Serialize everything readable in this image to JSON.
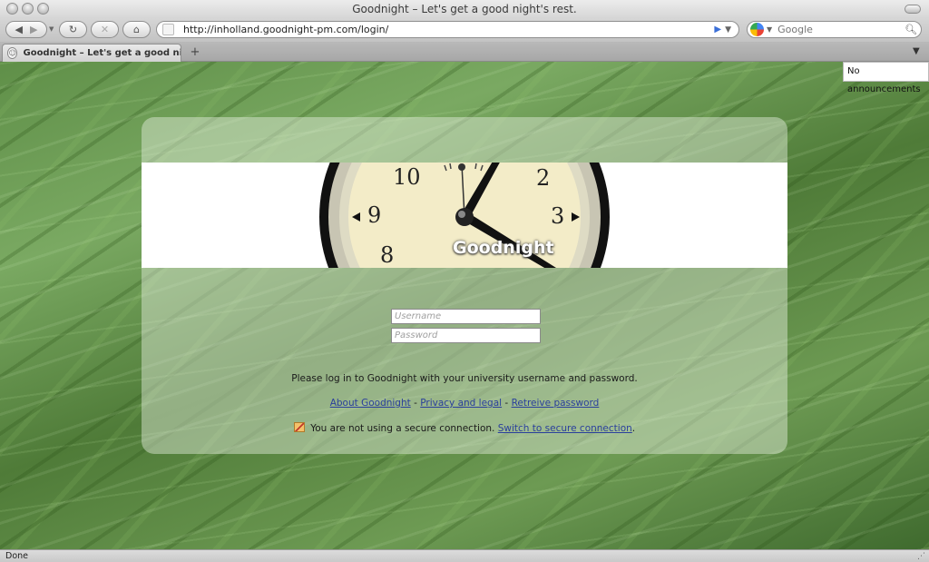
{
  "window": {
    "title": "Goodnight – Let's get a good night's rest."
  },
  "toolbar": {
    "url": "http://inholland.goodnight-pm.com/login/",
    "search_placeholder": "Google"
  },
  "tabs": [
    {
      "label": "Goodnight – Let's get a good nigh..."
    }
  ],
  "page": {
    "announcement": "No announcements",
    "logo_text": "Goodnight",
    "clock_numerals": [
      "10",
      "2",
      "9",
      "3",
      "8"
    ],
    "username_placeholder": "Username",
    "password_placeholder": "Password",
    "login_prompt": "Please log in to Goodnight with your university username and password.",
    "links": {
      "about": "About Goodnight",
      "separator": "-",
      "privacy": "Privacy and legal",
      "retrieve": "Retreive password"
    },
    "secure": {
      "message": "You are not using a secure connection.",
      "switch_link": "Switch to secure connection",
      "end": "."
    }
  },
  "status": {
    "text": "Done"
  },
  "colors": {
    "link": "#2a3f9c",
    "panel": "rgba(230,240,225,0.45)",
    "clock_face": "#f3ecc8"
  }
}
